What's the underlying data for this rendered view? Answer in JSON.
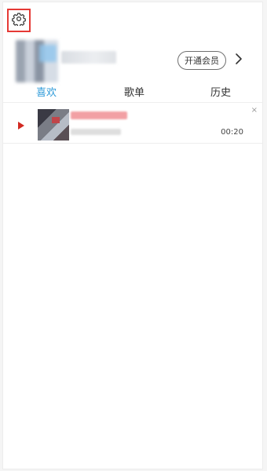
{
  "header": {
    "settings_icon": "gear-icon",
    "vip_button_label": "开通会员",
    "chevron_icon": "chevron-right-icon"
  },
  "tabs": [
    {
      "label": "喜欢",
      "active": true
    },
    {
      "label": "歌单",
      "active": false
    },
    {
      "label": "历史",
      "active": false
    }
  ],
  "list": {
    "items": [
      {
        "duration": "00:20",
        "close_label": "×"
      }
    ]
  },
  "colors": {
    "accent_tab": "#2f9bd9",
    "play_indicator": "#d22a22",
    "highlight_box": "#e53935"
  }
}
